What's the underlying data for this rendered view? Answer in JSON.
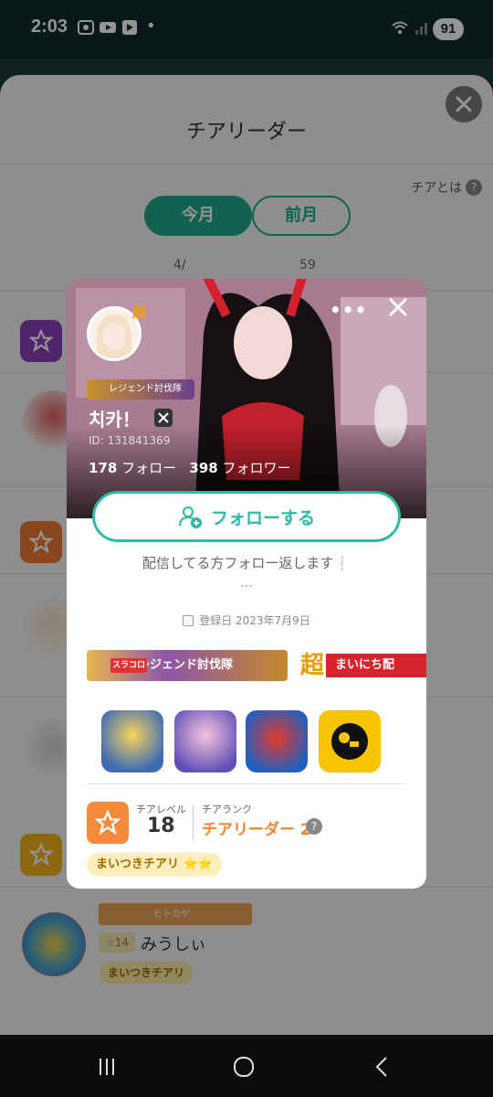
{
  "status_bar": {
    "time": "2:03",
    "battery": "91"
  },
  "sheet": {
    "title": "チアリーダー",
    "help_link": "チアとは",
    "tabs": [
      "今月",
      "前月"
    ],
    "period_text": "4/",
    "period_text_end": "59",
    "list_visible": {
      "name": "みうしぃ",
      "level": "☆14",
      "pill": "まいつきチアリ",
      "banner": "ヒトカゲ"
    }
  },
  "profile": {
    "super_mark": "超",
    "hero_badge": "レジェンド討伐隊",
    "username": "치카！",
    "user_id": "ID: 131841369",
    "following_count": "178",
    "following_label": "フォロー",
    "followers_count": "398",
    "followers_label": "フォロワー",
    "follow_button": "フォローする",
    "bio": "配信してる方フォロー返します❕",
    "bio_more": "…",
    "registered": "登録日 2023年7月9日",
    "badges": {
      "legend_prefix": "スラコロ",
      "legend": "レジェンド討伐隊",
      "super_mark": "超",
      "daily": "まいにち配"
    },
    "games": [
      "seven-deadly-sins-icon",
      "anime-idol-game-icon",
      "monster-strike-icon",
      "brawl-stars-icon"
    ],
    "cheer_level_label": "チアレベル",
    "cheer_level_value": "18",
    "cheer_rank_label": "チアランク",
    "cheer_rank_value": "チアリーダー 2",
    "daily_cheer_pill": "まいつきチアリ ⭐⭐"
  },
  "colors": {
    "accent": "#2cb9a6",
    "tab_active": "#1faa8a",
    "rank_orange": "#f0852e"
  }
}
